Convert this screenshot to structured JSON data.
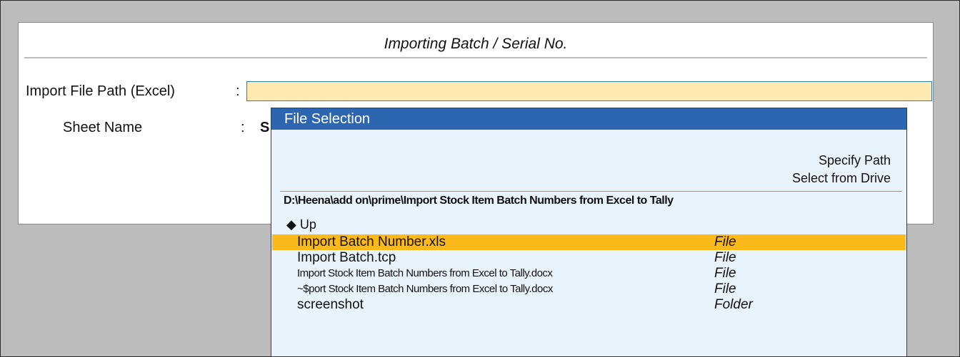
{
  "form": {
    "title": "Importing Batch / Serial No.",
    "import_file_path_label": "Import File Path (Excel)",
    "import_file_path_value": "",
    "sheet_name_label": "Sheet Name",
    "sheet_name_value": "S",
    "colon": ":"
  },
  "file_selection": {
    "title": "File Selection",
    "options": [
      "Specify Path",
      "Select from Drive"
    ],
    "current_path": "D:\\Heena\\add on\\prime\\Import Stock Item Batch Numbers from Excel to Tally",
    "up_label": "◆ Up",
    "items": [
      {
        "name": "Import Batch Number.xls",
        "type": "File",
        "selected": true
      },
      {
        "name": "Import Batch.tcp",
        "type": "File",
        "selected": false
      },
      {
        "name": "Import Stock Item Batch Numbers from Excel to Tally.docx",
        "type": "File",
        "selected": false
      },
      {
        "name": "~$port Stock Item Batch Numbers from Excel to Tally.docx",
        "type": "File",
        "selected": false
      },
      {
        "name": "screenshot",
        "type": "Folder",
        "selected": false
      }
    ]
  },
  "colors": {
    "header_bg": "#2d66b0",
    "selection": "#fbb91a",
    "input_bg": "#fde9b2",
    "popup_bg": "#e9f3fb"
  }
}
